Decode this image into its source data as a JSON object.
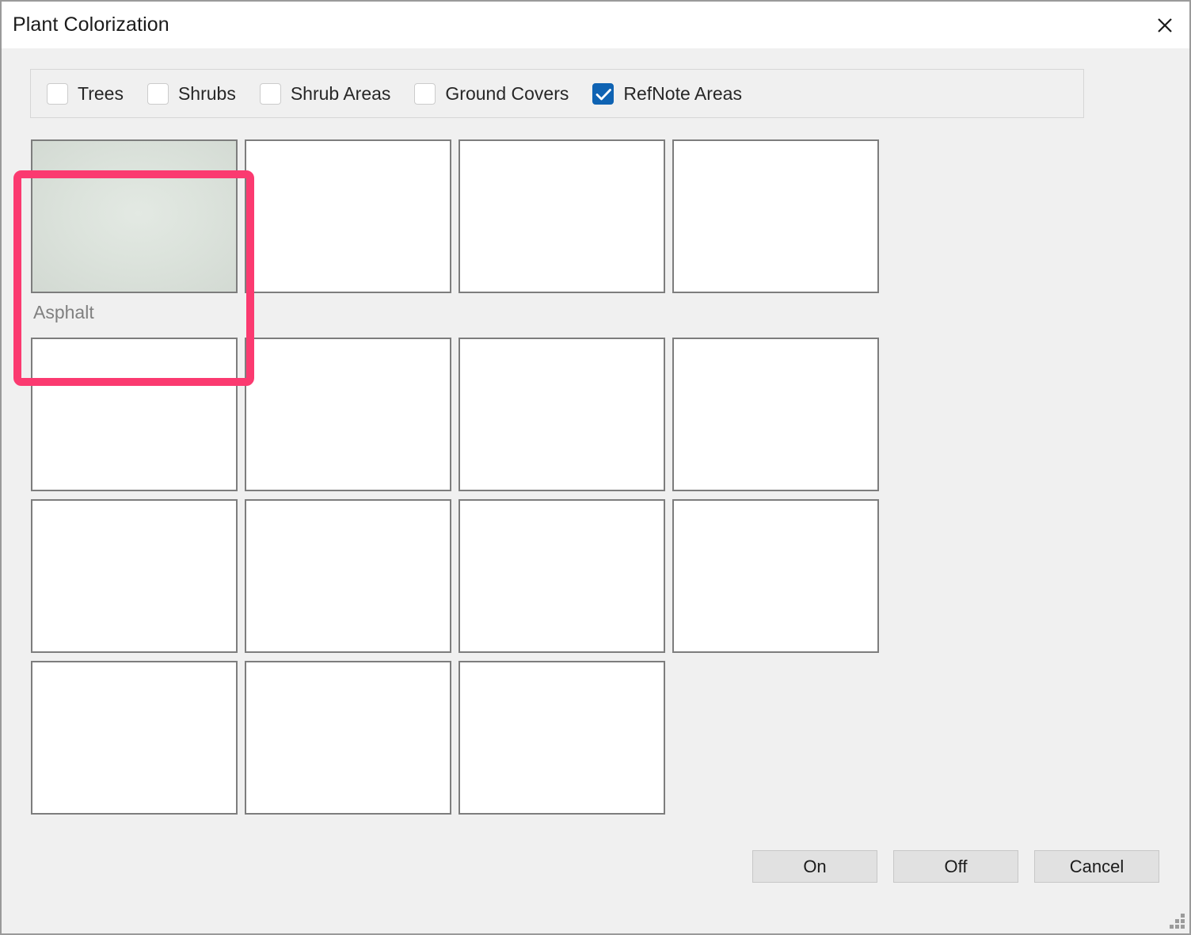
{
  "window": {
    "title": "Plant Colorization",
    "close_icon": "close-icon"
  },
  "filters": {
    "items": [
      {
        "label": "Trees",
        "checked": false
      },
      {
        "label": "Shrubs",
        "checked": false
      },
      {
        "label": "Shrub Areas",
        "checked": false
      },
      {
        "label": "Ground Covers",
        "checked": false
      },
      {
        "label": "RefNote Areas",
        "checked": true
      }
    ],
    "checked_color": "#0f63b3"
  },
  "grid": {
    "columns": 5,
    "rows": 3,
    "selection_color": "#fb3a70",
    "cells": [
      {
        "label": "Asphalt",
        "filled": true,
        "swatch_color": "#dce3dc",
        "selected": true
      },
      {
        "label": "",
        "filled": false,
        "selected": false
      },
      {
        "label": "",
        "filled": false,
        "selected": false
      },
      {
        "label": "",
        "filled": false,
        "selected": false
      },
      {
        "label": "",
        "filled": false,
        "selected": false
      },
      {
        "label": "",
        "filled": false,
        "selected": false
      },
      {
        "label": "",
        "filled": false,
        "selected": false
      },
      {
        "label": "",
        "filled": false,
        "selected": false
      },
      {
        "label": "",
        "filled": false,
        "selected": false
      },
      {
        "label": "",
        "filled": false,
        "selected": false
      },
      {
        "label": "",
        "filled": false,
        "selected": false
      },
      {
        "label": "",
        "filled": false,
        "selected": false
      },
      {
        "label": "",
        "filled": false,
        "selected": false
      },
      {
        "label": "",
        "filled": false,
        "selected": false
      },
      {
        "label": "",
        "filled": false,
        "selected": false
      }
    ]
  },
  "footer": {
    "on_label": "On",
    "off_label": "Off",
    "cancel_label": "Cancel"
  },
  "resize_grip": "resize-grip-icon"
}
